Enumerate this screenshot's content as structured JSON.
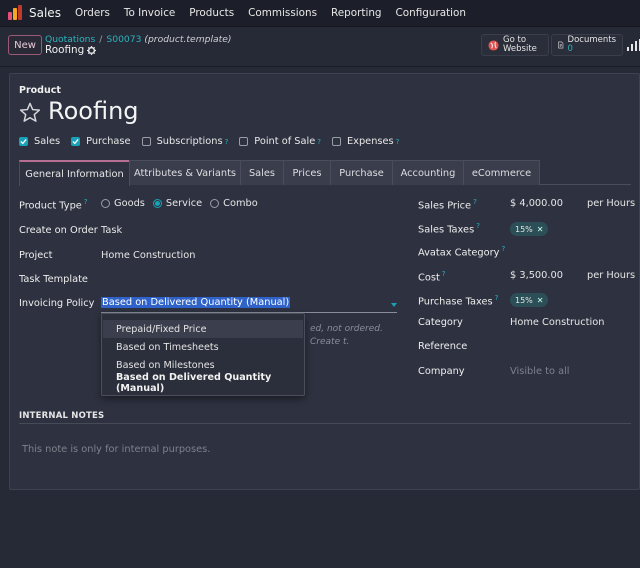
{
  "navbar": {
    "app_name": "Sales",
    "menu": [
      "Orders",
      "To Invoice",
      "Products",
      "Commissions",
      "Reporting",
      "Configuration"
    ],
    "app_icon_colors": [
      "#e94e77",
      "#f5a623",
      "#c0392b"
    ]
  },
  "control_panel": {
    "new_label": "New",
    "breadcrumb": {
      "root": "Quotations",
      "separator": "/",
      "parent": "S00073",
      "model": "(product.template)"
    },
    "record_title": "Roofing",
    "smart_buttons": {
      "website": {
        "line1": "Go to",
        "line2": "Website",
        "icon": "globe-icon"
      },
      "documents": {
        "label": "Documents",
        "count": "0",
        "icon": "document-icon"
      }
    }
  },
  "form": {
    "product_label": "Product",
    "product_name": "Roofing",
    "checkboxes": [
      {
        "label": "Sales",
        "checked": true,
        "help": false
      },
      {
        "label": "Purchase",
        "checked": true,
        "help": false
      },
      {
        "label": "Subscriptions",
        "checked": false,
        "help": true
      },
      {
        "label": "Point of Sale",
        "checked": false,
        "help": true
      },
      {
        "label": "Expenses",
        "checked": false,
        "help": true
      }
    ],
    "help_mark": "?",
    "tabs": [
      "General Information",
      "Attributes & Variants",
      "Sales",
      "Prices",
      "Purchase",
      "Accounting",
      "eCommerce"
    ],
    "active_tab": "General Information",
    "left": {
      "product_type": {
        "label": "Product Type",
        "options": [
          "Goods",
          "Service",
          "Combo"
        ],
        "selected": "Service"
      },
      "create_on_order": {
        "label": "Create on Order",
        "value": "Task"
      },
      "project": {
        "label": "Project",
        "value": "Home Construction"
      },
      "task_template": {
        "label": "Task Template",
        "value": ""
      },
      "invoicing_policy": {
        "label": "Invoicing Policy",
        "value": "Based on Delivered Quantity (Manual)",
        "options": [
          "Prepaid/Fixed Price",
          "Based on Timesheets",
          "Based on Milestones",
          "Based on Delivered Quantity (Manual)"
        ],
        "hovered": "Prepaid/Fixed Price"
      },
      "hint_text": "ed, not ordered. Create t."
    },
    "right": {
      "sales_price": {
        "label": "Sales Price",
        "value": "$ 4,000.00",
        "unit": "per Hours"
      },
      "sales_taxes": {
        "label": "Sales Taxes",
        "tag": "15%"
      },
      "avatax_category": {
        "label": "Avatax Category",
        "value": ""
      },
      "cost": {
        "label": "Cost",
        "value": "$ 3,500.00",
        "unit": "per Hours"
      },
      "purchase_taxes": {
        "label": "Purchase Taxes",
        "tag": "15%"
      },
      "category": {
        "label": "Category",
        "value": "Home Construction"
      },
      "reference": {
        "label": "Reference",
        "value": ""
      },
      "company": {
        "label": "Company",
        "placeholder": "Visible to all"
      }
    },
    "notes": {
      "header": "INTERNAL NOTES",
      "placeholder": "This note is only for internal purposes."
    }
  },
  "colors": {
    "accent_teal": "#17a2b8",
    "brand_pink": "#b66f93",
    "selection_blue": "#2f63c9"
  }
}
